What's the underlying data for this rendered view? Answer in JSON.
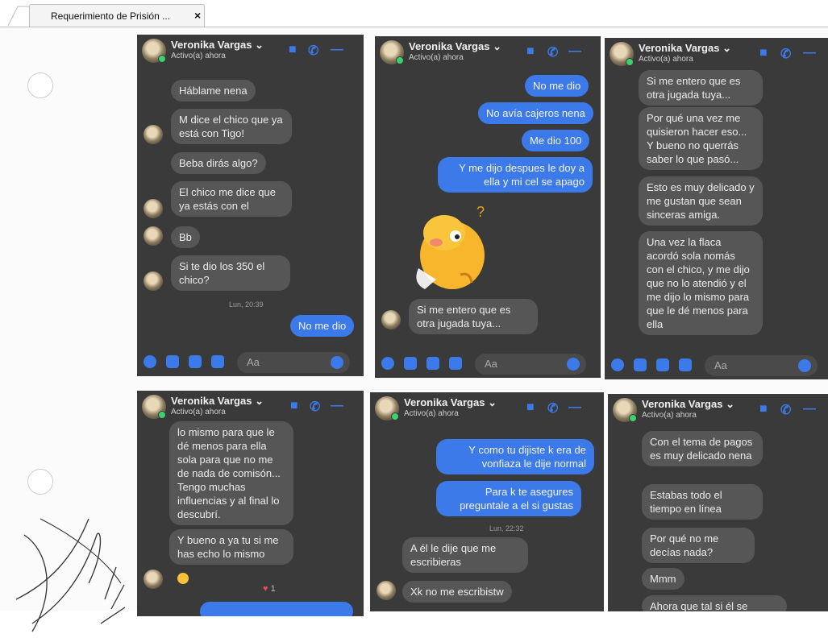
{
  "tab": {
    "title": "Requerimiento de Prisión ...",
    "close": "×"
  },
  "contact": {
    "name": "Veronika Vargas ⌄",
    "status": "Activo(a) ahora"
  },
  "composer_placeholder": "Aa",
  "accent_color": "#3b7ae8",
  "panels": [
    {
      "messages": [
        "Háblame nena",
        "M dice el chico que ya está con Tigo!",
        "Beba dirás algo?",
        "El chico me dice que ya estás con el",
        "Bb",
        "Si te dio los 350 el chico?",
        "Lun, 20:39",
        "No me dio"
      ]
    },
    {
      "messages": [
        "No me dio",
        "No avía cajeros nena",
        "Me dio 100",
        "Y me dijo despues le doy a ella y mi cel se apago",
        "Si me entero que es otra jugada tuya..."
      ]
    },
    {
      "messages": [
        "Si me entero que es otra jugada tuya...",
        "Por qué una vez me quisieron hacer eso... Y bueno no querrás saber lo que pasó...",
        "Esto es muy delicado y me gustan que sean sinceras amiga.",
        "Una vez la flaca acordó sola nomás con el chico, y me dijo que no lo atendió y el me dijo lo mismo para que le dé menos para ella"
      ]
    },
    {
      "messages": [
        "lo mismo para que le dé menos para ella sola para que no me de nada de comisón... Tengo muchas influencias y al final lo descubrí.",
        "Y bueno a ya tu si me has echo lo mismo",
        "1"
      ]
    },
    {
      "messages": [
        "Y como tu dijiste k era de vonfiaza le dije normal",
        "Para k te asegures preguntale a el si gustas",
        "Lun, 22:32",
        "A él le dije que me escribieras",
        "Xk no me escribistw"
      ]
    },
    {
      "messages": [
        "Con el tema de pagos es muy delicado nena",
        "Estabas todo el tiempo en línea",
        "Por qué no me decías nada?",
        "Mmm",
        "Ahora que tal si él se"
      ]
    }
  ]
}
